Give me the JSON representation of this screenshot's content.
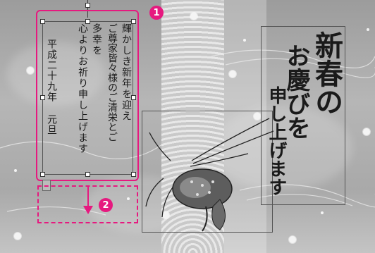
{
  "greeting": {
    "columns": [
      "輝かしき新年を迎え",
      "ご尊家皆々様のご清栄とご",
      "多幸を",
      "心よりお祈り申し上げます",
      "",
      "平成二十九年 元旦"
    ]
  },
  "title_art": {
    "col1": "新春の",
    "col2": "お慶びを",
    "col3": "申し上げます"
  },
  "annotations": {
    "step1": "1",
    "step2": "2"
  },
  "colors": {
    "accent": "#e6197f",
    "frame": "#555555",
    "text": "#1a1a1a"
  },
  "icons": {
    "illustration": "spiny-lobster",
    "arrow": "arrow-down-icon"
  }
}
